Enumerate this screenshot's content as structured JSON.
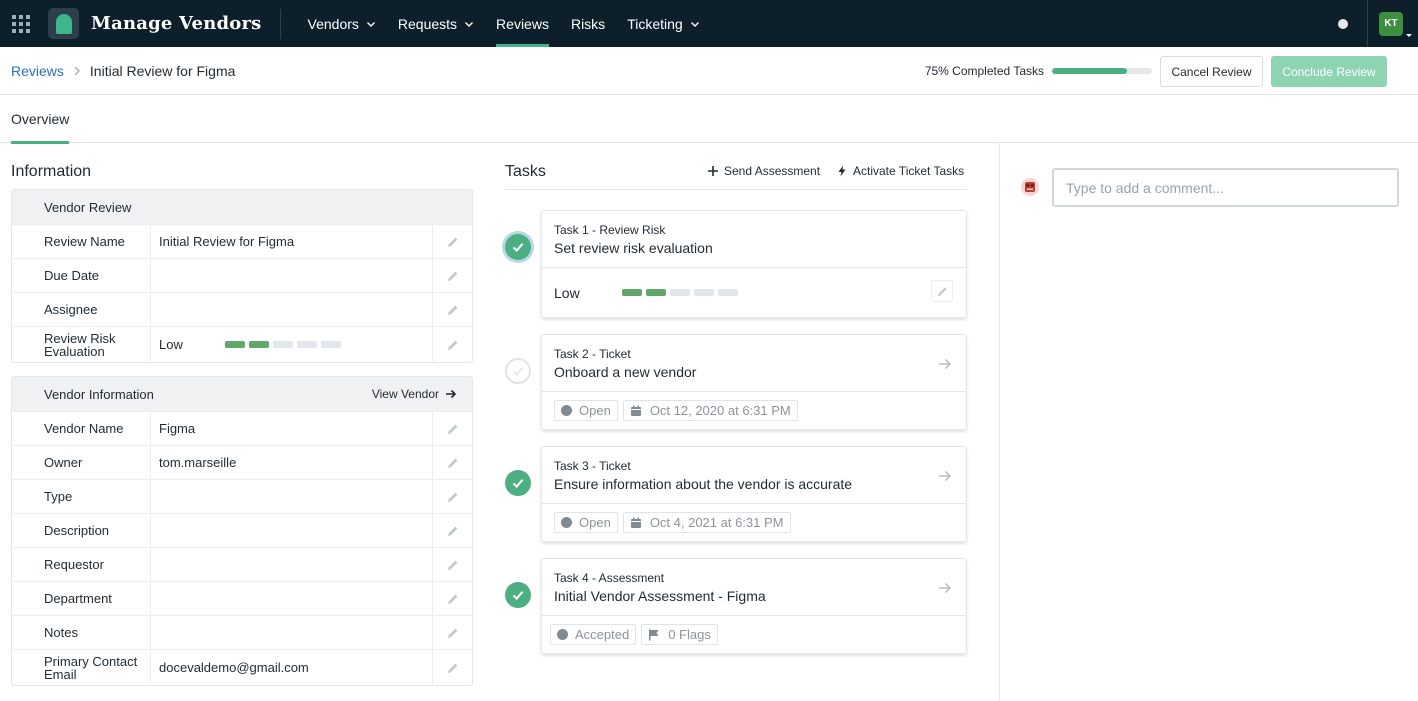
{
  "app": {
    "title": "Manage Vendors",
    "user_initials": "KT"
  },
  "nav": {
    "items": [
      {
        "label": "Vendors",
        "dropdown": true,
        "active": false
      },
      {
        "label": "Requests",
        "dropdown": true,
        "active": false
      },
      {
        "label": "Reviews",
        "dropdown": false,
        "active": true
      },
      {
        "label": "Risks",
        "dropdown": false,
        "active": false
      },
      {
        "label": "Ticketing",
        "dropdown": true,
        "active": false
      }
    ]
  },
  "breadcrumb": {
    "parent": "Reviews",
    "current": "Initial Review for Figma"
  },
  "progress": {
    "label": "75% Completed Tasks",
    "fraction": 0.75
  },
  "actions": {
    "cancel": "Cancel Review",
    "conclude": "Conclude Review"
  },
  "tabs": {
    "overview": "Overview"
  },
  "information": {
    "title": "Information",
    "vendor_review": {
      "header": "Vendor Review",
      "rows": [
        {
          "label": "Review Name",
          "value": "Initial Review for Figma"
        },
        {
          "label": "Due Date",
          "value": ""
        },
        {
          "label": "Assignee",
          "value": ""
        },
        {
          "label": "Review Risk Evaluation",
          "value": "Low",
          "risk_level": 2,
          "risk_max": 5
        }
      ]
    },
    "vendor_information": {
      "header": "Vendor Information",
      "view_link": "View Vendor",
      "rows": [
        {
          "label": "Vendor Name",
          "value": "Figma"
        },
        {
          "label": "Owner",
          "value": "tom.marseille"
        },
        {
          "label": "Type",
          "value": ""
        },
        {
          "label": "Description",
          "value": ""
        },
        {
          "label": "Requestor",
          "value": ""
        },
        {
          "label": "Department",
          "value": ""
        },
        {
          "label": "Notes",
          "value": ""
        },
        {
          "label": "Primary Contact Email",
          "value": "docevaldemo@gmail.com"
        }
      ]
    }
  },
  "tasks": {
    "title": "Tasks",
    "send_assessment": "Send Assessment",
    "activate_ticket_tasks": "Activate Ticket Tasks",
    "items": [
      {
        "kicker": "Task 1 - Review Risk",
        "name": "Set review risk evaluation",
        "done": true,
        "risk_label": "Low",
        "risk_level": 2,
        "risk_max": 5
      },
      {
        "kicker": "Task 2 - Ticket",
        "name": "Onboard a new vendor",
        "done": false,
        "status": "Open",
        "date": "Oct 12, 2020 at 6:31 PM"
      },
      {
        "kicker": "Task 3 - Ticket",
        "name": "Ensure information about the vendor is accurate",
        "done": true,
        "status": "Open",
        "date": "Oct 4, 2021 at 6:31 PM"
      },
      {
        "kicker": "Task 4 - Assessment",
        "name": "Initial Vendor Assessment - Figma",
        "done": true,
        "status": "Accepted",
        "flags": "0 Flags"
      }
    ]
  },
  "comments": {
    "placeholder": "Type to add a comment..."
  },
  "colors": {
    "accent": "#4caf82",
    "nav_bg": "#0d1f2b",
    "link": "#2d6fb8",
    "conclude_btn": "#8fd4b2"
  }
}
